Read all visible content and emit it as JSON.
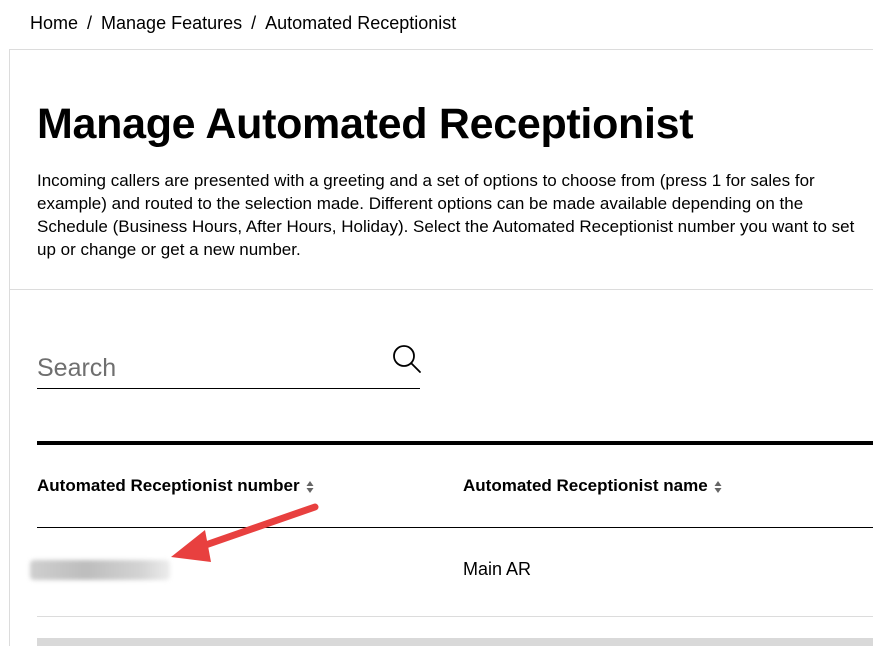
{
  "breadcrumb": {
    "items": [
      "Home",
      "Manage Features",
      "Automated Receptionist"
    ],
    "separator": "/"
  },
  "page": {
    "title": "Manage Automated Receptionist",
    "description": "Incoming callers are presented with a greeting and a set of options to choose from (press 1 for sales for example) and routed to the selection made. Different options can be made available depending on the Schedule (Business Hours, After Hours, Holiday). Select the Automated Receptionist number you want to set up or change or get a new number."
  },
  "search": {
    "placeholder": "Search",
    "value": "",
    "icon": "search-icon"
  },
  "table": {
    "columns": [
      {
        "label": "Automated Receptionist number",
        "sort_icon": "sort-icon"
      },
      {
        "label": "Automated Receptionist name",
        "sort_icon": "sort-icon"
      }
    ],
    "rows": [
      {
        "number": "",
        "name": "Main AR"
      }
    ]
  },
  "annotation": {
    "arrow_color": "#e8403f"
  }
}
